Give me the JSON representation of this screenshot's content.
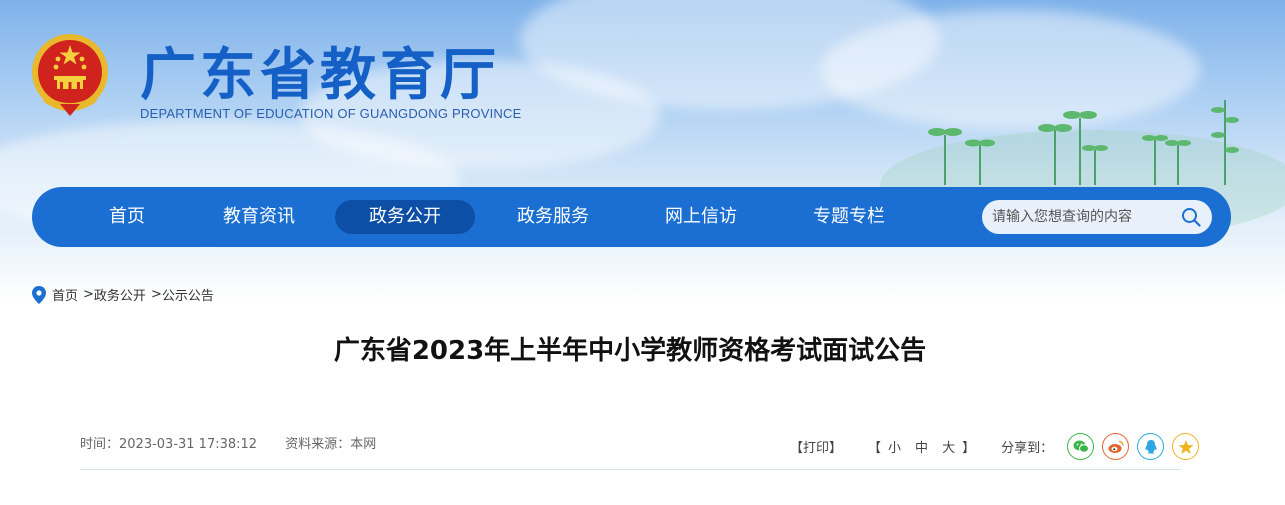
{
  "header": {
    "title": "广东省教育厅",
    "subtitle": "DEPARTMENT OF EDUCATION OF GUANGDONG PROVINCE",
    "emblem_icon": "national-emblem-icon",
    "brand_color": "#1560c6"
  },
  "nav": {
    "items": [
      {
        "label": "首页",
        "active": false
      },
      {
        "label": "教育资讯",
        "active": false
      },
      {
        "label": "政务公开",
        "active": true
      },
      {
        "label": "政务服务",
        "active": false
      },
      {
        "label": "网上信访",
        "active": false
      },
      {
        "label": "专题专栏",
        "active": false
      }
    ],
    "bar_color": "#1b6fd3",
    "active_color": "#0d4fa6"
  },
  "search": {
    "placeholder": "请输入您想查询的内容",
    "icon": "search-icon"
  },
  "breadcrumb": {
    "icon": "location-pin-icon",
    "items": [
      "首页",
      "政务公开",
      "公示公告"
    ],
    "separator": ">"
  },
  "article": {
    "title": "广东省2023年上半年中小学教师资格考试面试公告",
    "time_label": "时间：2023-03-31 17:38:12",
    "source_label": "资料来源：本网"
  },
  "tools": {
    "print": "【打印】",
    "font_open": "【",
    "font_small": "小",
    "font_medium": "中",
    "font_large": "大",
    "font_close": "】",
    "share_label": "分享到：",
    "share_icons": [
      {
        "name": "wechat-icon",
        "color": "#3bb44a"
      },
      {
        "name": "weibo-icon",
        "color": "#e6612c"
      },
      {
        "name": "qq-icon",
        "color": "#2da6e3"
      },
      {
        "name": "qzone-icon",
        "color": "#f0b320"
      }
    ]
  }
}
